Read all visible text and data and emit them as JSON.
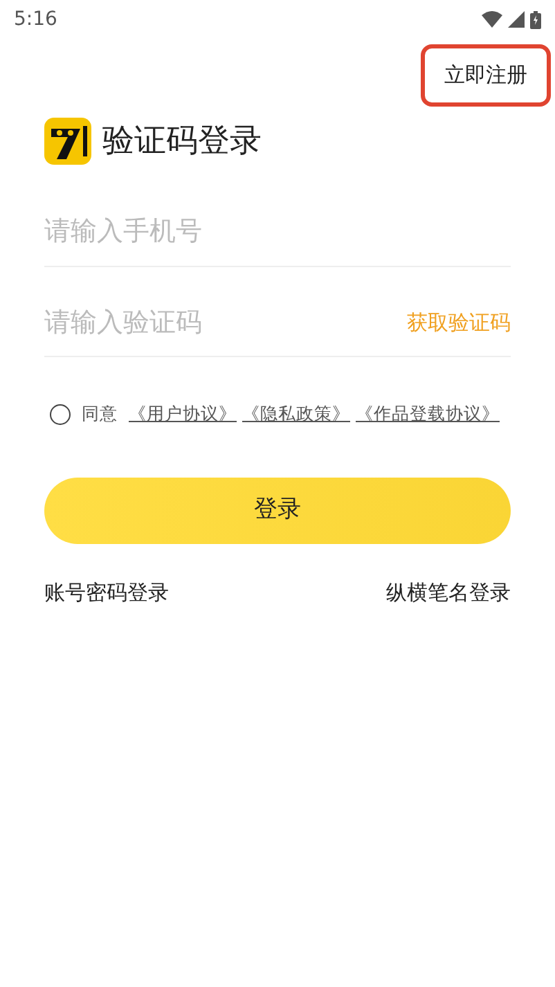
{
  "status_bar": {
    "time": "5:16"
  },
  "register_button": {
    "label": "立即注册",
    "highlighted": true
  },
  "title": "验证码登录",
  "phone_field": {
    "placeholder": "请输入手机号"
  },
  "code_field": {
    "placeholder": "请输入验证码",
    "action": "获取验证码"
  },
  "agreement": {
    "checked": false,
    "text": "同意",
    "links": [
      "《用户协议》",
      "《隐私政策》",
      "《作品登载协议》"
    ]
  },
  "login_button": "登录",
  "alt_logins": [
    "账号密码登录",
    "纵横笔名登录"
  ]
}
